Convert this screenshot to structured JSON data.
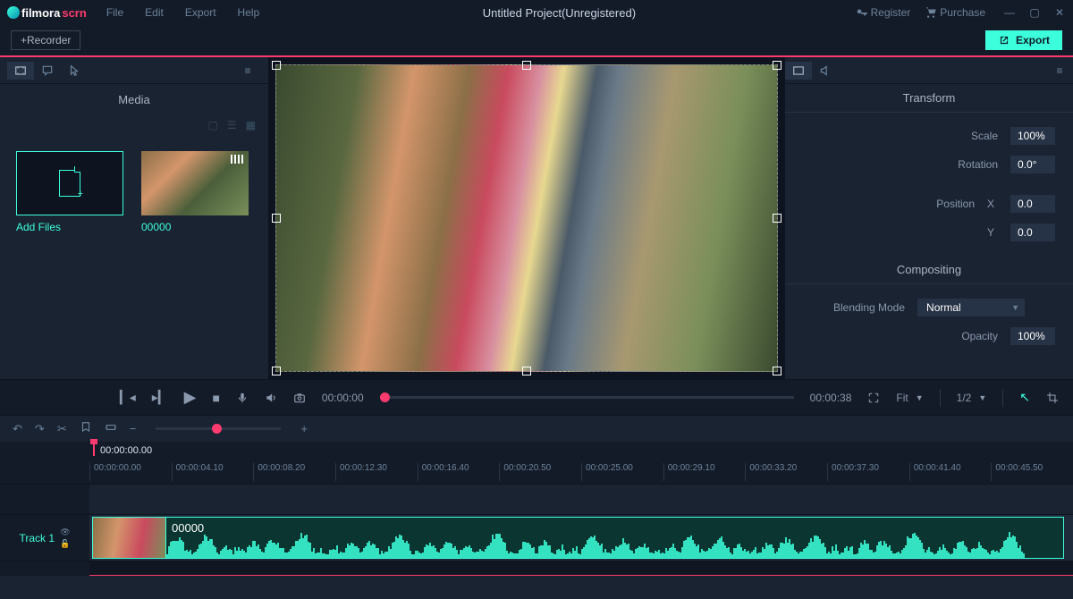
{
  "logo": {
    "part1": "filmora",
    "part2": "scrn"
  },
  "menu": {
    "file": "File",
    "edit": "Edit",
    "export": "Export",
    "help": "Help"
  },
  "title": "Untitled Project(Unregistered)",
  "register": "Register",
  "purchase": "Purchase",
  "recorder_btn": "+Recorder",
  "export_btn": "Export",
  "media_panel": {
    "title": "Media",
    "add_files": "Add Files",
    "clip_name": "00000"
  },
  "playback": {
    "current_time": "00:00:00",
    "total_time": "00:00:38",
    "fit_label": "Fit",
    "scale_label": "1/2"
  },
  "timeline": {
    "playhead_time": "00:00:00.00",
    "ticks": [
      "00:00:00.00",
      "00:00:04.10",
      "00:00:08.20",
      "00:00:12.30",
      "00:00:16.40",
      "00:00:20.50",
      "00:00:25.00",
      "00:00:29.10",
      "00:00:33.20",
      "00:00:37.30",
      "00:00:41.40",
      "00:00:45.50"
    ],
    "track1_label": "Track 1",
    "clip_label": "00000"
  },
  "properties": {
    "transform_title": "Transform",
    "scale_label": "Scale",
    "scale_value": "100%",
    "rotation_label": "Rotation",
    "rotation_value": "0.0°",
    "position_label": "Position",
    "pos_x_label": "X",
    "pos_x_value": "0.0",
    "pos_y_label": "Y",
    "pos_y_value": "0.0",
    "compositing_title": "Compositing",
    "blend_label": "Blending Mode",
    "blend_value": "Normal",
    "opacity_label": "Opacity",
    "opacity_value": "100%"
  }
}
